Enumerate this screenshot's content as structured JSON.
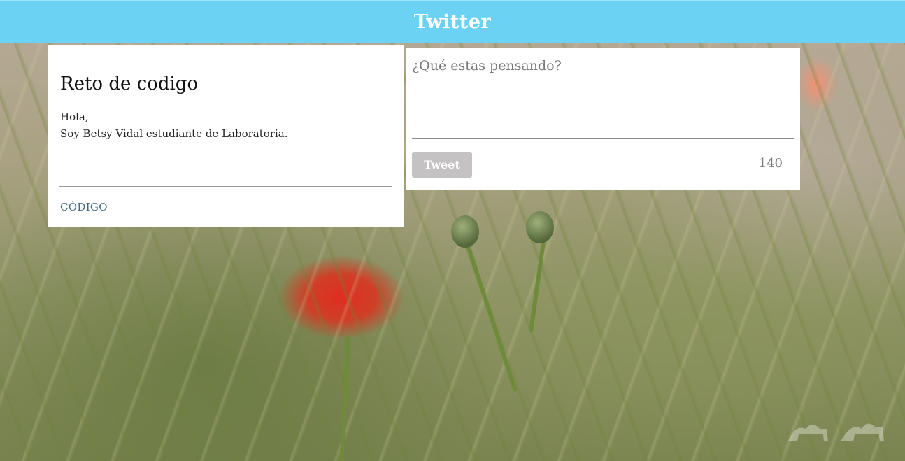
{
  "header": {
    "title": "Twitter"
  },
  "card": {
    "title": "Reto de codigo",
    "greeting": "Hola,",
    "intro": "Soy Betsy Vidal estudiante de Laboratoria.",
    "link_label": "CÓDIGO"
  },
  "composer": {
    "placeholder": "¿Qué estas pensando?",
    "value": "",
    "tweet_label": "Tweet",
    "char_count": "140"
  },
  "colors": {
    "header_bg": "#6bd2f4",
    "tweet_button_bg": "#c4c2c2",
    "link": "#3d6b86"
  }
}
